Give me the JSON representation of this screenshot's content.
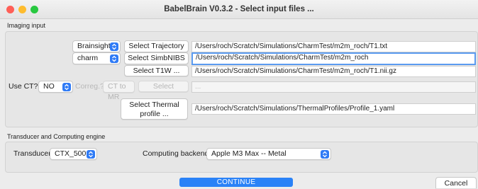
{
  "window": {
    "title": "BabelBrain V0.3.2 - Select input files ..."
  },
  "imaging": {
    "group_label": "Imaging input",
    "trajectory_source": "Brainsight",
    "select_trajectory_label": "Select Trajectory ...",
    "trajectory_path": "/Users/roch/Scratch/Simulations/CharmTest/m2m_roch/T1.txt",
    "segmentation_tool": "charm",
    "select_simbnibs_label": "Select SimbNIBS ...",
    "simbnibs_path": "/Users/roch/Scratch/Simulations/CharmTest/m2m_roch",
    "select_t1w_label": "Select T1W ...",
    "t1w_path": "/Users/roch/Scratch/Simulations/CharmTest/m2m_roch/T1.nii.gz",
    "use_ct_label": "Use CT?",
    "use_ct_value": "NO",
    "coreg_label": "Correg.?",
    "ct_to_mr_value": "CT to MR",
    "select_ct_label": "Select",
    "ct_path": "...",
    "select_thermal_label": "Select Thermal profile ...",
    "thermal_path": "/Users/roch/Scratch/Simulations/ThermalProfiles/Profile_1.yaml"
  },
  "transducer": {
    "group_label": "Transducer and Computing engine",
    "transducer_label": "Transducer",
    "transducer_value": "CTX_500",
    "backend_label": "Computing backend",
    "backend_value": "Apple M3 Max -- Metal"
  },
  "footer": {
    "continue_label": "CONTINUE",
    "cancel_label": "Cancel"
  },
  "colors": {
    "accent": "#2a82f7",
    "close": "#ff5f57",
    "minimize": "#febc2e",
    "zoom": "#28c840"
  }
}
